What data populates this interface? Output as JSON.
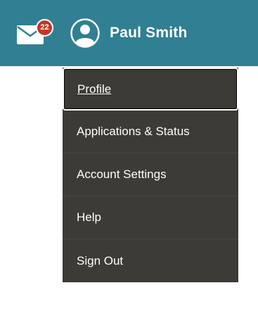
{
  "header": {
    "background_color": "#317f92",
    "mail": {
      "icon": "envelope-icon",
      "unread_count": "22",
      "badge_color": "#c0392b"
    },
    "user": {
      "icon": "user-avatar-icon",
      "name": "Paul Smith"
    }
  },
  "dropdown": {
    "background_color": "#3c3b35",
    "items": [
      {
        "label": "Profile",
        "focused": true
      },
      {
        "label": "Applications & Status"
      },
      {
        "label": "Account Settings"
      },
      {
        "label": "Help"
      },
      {
        "label": "Sign Out"
      }
    ]
  }
}
